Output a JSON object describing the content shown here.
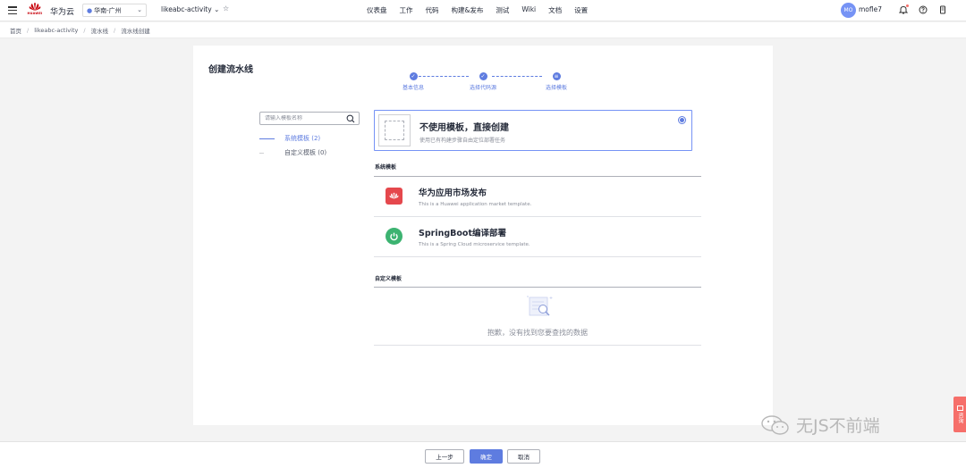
{
  "header": {
    "brand": "华为云",
    "logo_text": "HUAWEI",
    "region": "华南-广州",
    "project": "likeabc-activity",
    "nav": [
      "仪表盘",
      "工作",
      "代码",
      "构建&发布",
      "测试",
      "Wiki",
      "文档",
      "设置"
    ],
    "user_avatar": "MO",
    "username": "mofle7"
  },
  "breadcrumb": [
    "首页",
    "likeabc-activity",
    "流水线",
    "流水线创建"
  ],
  "page": {
    "title": "创建流水线",
    "steps": [
      "基本信息",
      "选择代码源",
      "选择模板"
    ],
    "current_step": 3
  },
  "filter": {
    "search_placeholder": "请输入模板名称",
    "categories": [
      {
        "label": "系统模板 (2)",
        "active": true
      },
      {
        "label": "自定义模板 (0)",
        "active": false
      }
    ]
  },
  "blank_option": {
    "title": "不使用模板，直接创建",
    "desc": "使用已有构建步骤自由定位部署任务",
    "selected": true
  },
  "system_section": {
    "title": "系统模板",
    "templates": [
      {
        "title": "华为应用市场发布",
        "desc": "This is a Huawei application market template.",
        "icon": "huawei-market-icon",
        "color": "#e5484d"
      },
      {
        "title": "SpringBoot编译部署",
        "desc": "This is a Spring Cloud microservice template.",
        "icon": "springboot-power-icon",
        "color": "#3cb371"
      }
    ]
  },
  "custom_section": {
    "title": "自定义模板",
    "empty_text": "抱歉，没有找到您要查找的数据"
  },
  "footer": {
    "prev": "上一步",
    "confirm": "确定",
    "cancel": "取消"
  },
  "side_tab": "咨询",
  "watermark": "无JS不前端"
}
